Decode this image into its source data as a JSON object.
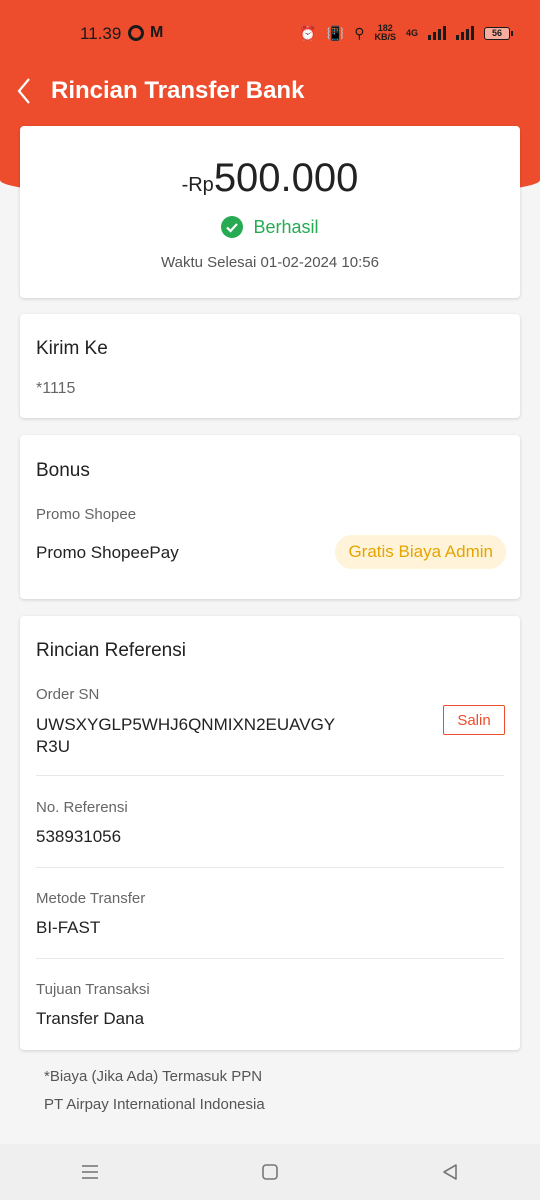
{
  "status_bar": {
    "time": "11.39",
    "net_speed_top": "182",
    "net_speed_bottom": "KB/S",
    "network_type": "4G",
    "battery": "56"
  },
  "header": {
    "title": "Rincian Transfer Bank"
  },
  "summary": {
    "amount_prefix": "-Rp",
    "amount": "500.000",
    "status": "Berhasil",
    "completed_time": "Waktu Selesai 01-02-2024 10:56"
  },
  "recipient": {
    "title": "Kirim Ke",
    "account": "*1115"
  },
  "bonus": {
    "title": "Bonus",
    "label": "Promo Shopee",
    "value": "Promo ShopeePay",
    "badge": "Gratis Biaya Admin"
  },
  "reference": {
    "title": "Rincian Referensi",
    "order_sn_label": "Order SN",
    "order_sn_line1": "UWSXYGLP5WHJ6QNMIXN2EUAVGY",
    "order_sn_line2": "R3U",
    "copy_label": "Salin",
    "ref_no_label": "No. Referensi",
    "ref_no_value": "538931056",
    "method_label": "Metode Transfer",
    "method_value": "BI-FAST",
    "purpose_label": "Tujuan Transaksi",
    "purpose_value": "Transfer Dana"
  },
  "footer": {
    "note": "*Biaya (Jika Ada) Termasuk PPN",
    "company": "PT Airpay International Indonesia"
  },
  "colors": {
    "brand": "#ee4d2d",
    "success": "#26aa52",
    "badge_text": "#e6a400",
    "badge_bg": "#fff4d9"
  },
  "icons": {
    "back": "chevron-left-icon",
    "success": "check-circle-icon",
    "nav_menu": "menu-icon",
    "nav_home": "square-icon",
    "nav_back": "triangle-back-icon"
  }
}
